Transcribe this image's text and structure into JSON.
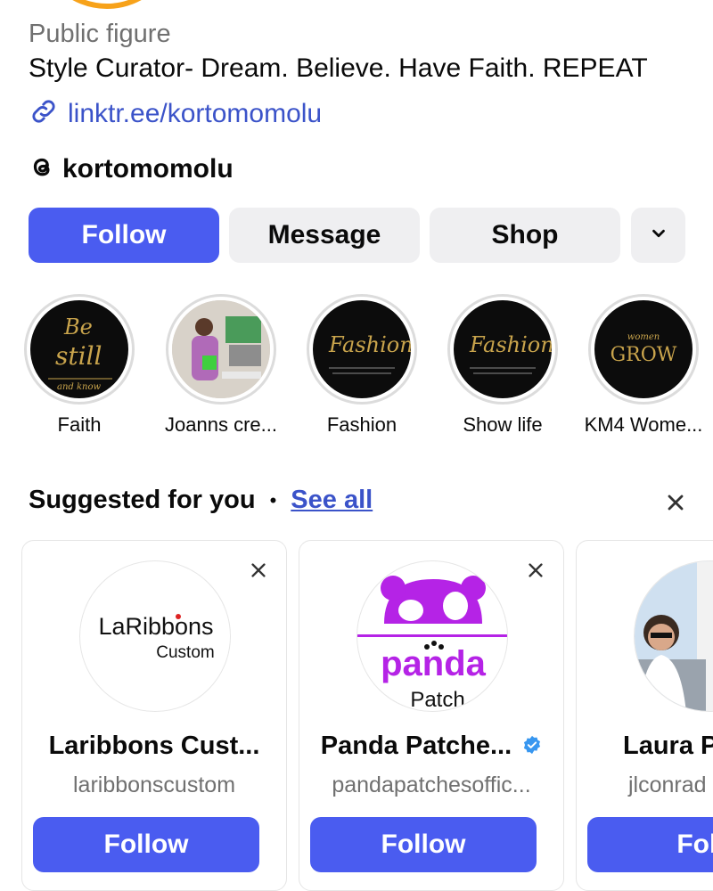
{
  "profile": {
    "category": "Public figure",
    "bio": "Style Curator- Dream. Believe. Have Faith. REPEAT",
    "link": "linktr.ee/kortomomolu",
    "threads_handle": "kortomomolu"
  },
  "actions": {
    "follow": "Follow",
    "message": "Message",
    "shop": "Shop"
  },
  "highlights": [
    {
      "label": "Faith",
      "cover_text_1": "Be",
      "cover_text_2": "still",
      "cover_text_3": "and know"
    },
    {
      "label": "Joanns cre..."
    },
    {
      "label": "Fashion",
      "cover_text_1": "Fashion:"
    },
    {
      "label": "Show life",
      "cover_text_1": "Fashion:"
    },
    {
      "label": "KM4 Wome...",
      "cover_text_1": "women",
      "cover_text_2": "GROW"
    }
  ],
  "suggested": {
    "title": "Suggested for you",
    "see_all": "See all",
    "cards": [
      {
        "name": "Laribbons Cust...",
        "username": "laribbonscustom",
        "follow": "Follow",
        "logo_main": "LaRibbons",
        "logo_sub": "Custom"
      },
      {
        "name": "Panda Patche...",
        "username": "pandapatchesoffic...",
        "follow": "Follow",
        "verified": true,
        "logo_main": "panda",
        "logo_sub": "Patch"
      },
      {
        "name": "Laura P",
        "username": "jlconrad",
        "follow": "Foll"
      }
    ]
  },
  "colors": {
    "primary": "#4a5cf0",
    "link": "#3b53c9",
    "secondary_btn": "#efeff1",
    "muted": "#707070",
    "panda": "#b523e6",
    "verified": "#3897f0"
  }
}
